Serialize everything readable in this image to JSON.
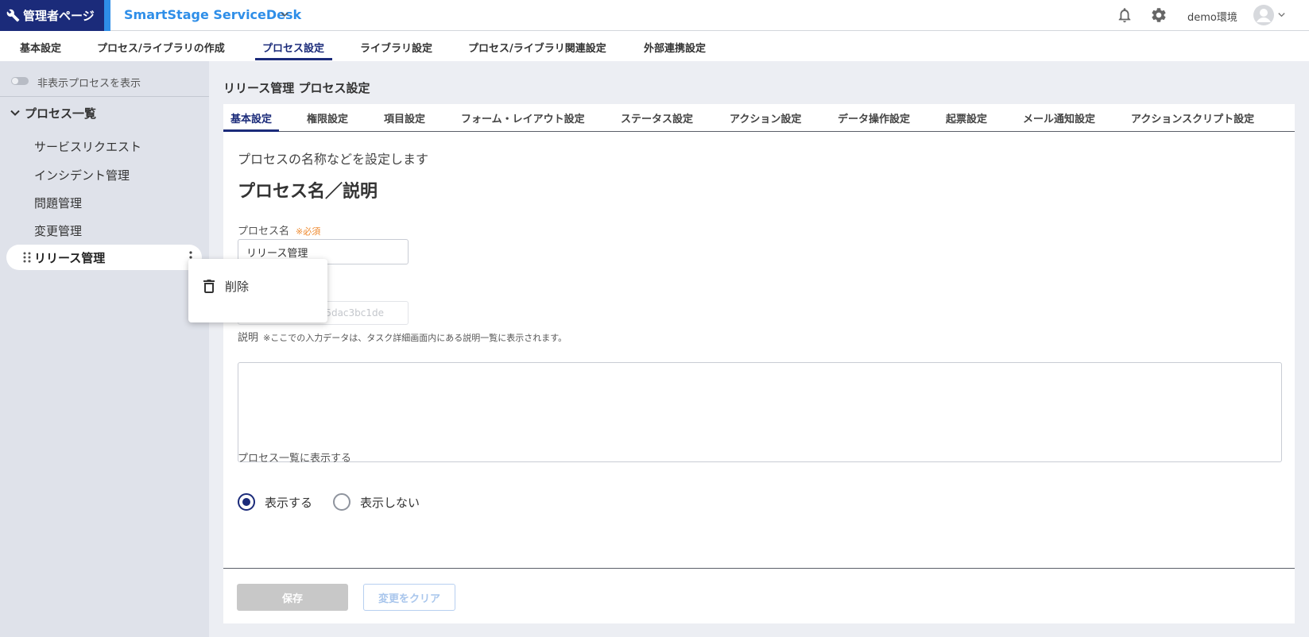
{
  "header": {
    "admin_label": "管理者ページ",
    "app_title": "SmartStage ServiceDesk",
    "environment": "demo環境"
  },
  "main_nav": {
    "tabs": [
      "基本設定",
      "プロセス/ライブラリの作成",
      "プロセス設定",
      "ライブラリ設定",
      "プロセス/ライブラリ関連設定",
      "外部連携設定"
    ],
    "active": "プロセス設定"
  },
  "sidebar": {
    "toggle_label": "非表示プロセスを表示",
    "section_title": "プロセス一覧",
    "items": [
      "サービスリクエスト",
      "インシデント管理",
      "問題管理",
      "変更管理",
      "リリース管理"
    ],
    "selected": "リリース管理"
  },
  "context_menu": {
    "items": [
      "削除"
    ]
  },
  "content": {
    "page_title": "リリース管理 プロセス設定",
    "subtabs": [
      "基本設定",
      "権限設定",
      "項目設定",
      "フォーム・レイアウト設定",
      "ステータス設定",
      "アクション設定",
      "データ操作設定",
      "起票設定",
      "メール通知設定",
      "アクションスクリプト設定"
    ],
    "active_subtab": "基本設定",
    "intro": "プロセスの名称などを設定します",
    "section_title": "プロセス名／説明",
    "process_name_label": "プロセス名",
    "required_mark": "※必須",
    "process_name_value": "リリース管理",
    "process_id_partial": "5dac3bc1de",
    "description_label": "説明",
    "description_note": "※ここでの入力データは、タスク詳細画面内にある説明一覧に表示されます。",
    "description_value": "",
    "show_in_list_label": "プロセス一覧に表示する",
    "radio_show": "表示する",
    "radio_hide": "表示しない",
    "radio_selected": "表示する",
    "save_button": "保存",
    "clear_button": "変更をクリア"
  },
  "colors": {
    "brand_navy": "#1b2b7a",
    "accent_blue": "#2e8ee8",
    "required_orange": "#ef8a2f"
  }
}
